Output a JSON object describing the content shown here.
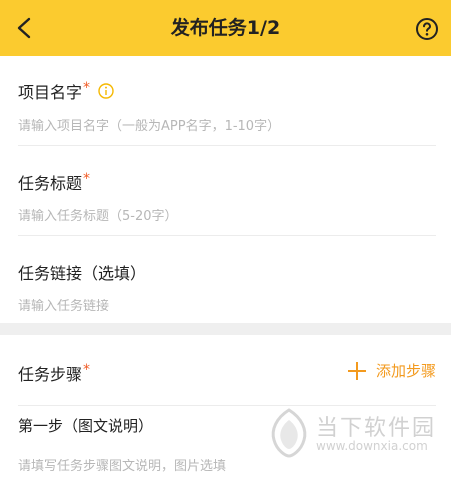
{
  "header": {
    "title": "发布任务1/2",
    "back_icon": "back-arrow-icon",
    "help_icon": "question-circle-icon",
    "bg_color": "#fbcb2f"
  },
  "form": {
    "project_name": {
      "label": "项目名字",
      "required_mark": "*",
      "info_icon": "info-circle-icon",
      "placeholder": "请输入项目名字（一般为APP名字，1-10字）"
    },
    "task_title": {
      "label": "任务标题",
      "required_mark": "*",
      "placeholder": "请输入任务标题（5-20字）"
    },
    "task_link": {
      "label": "任务链接（选填）",
      "placeholder": "请输入任务链接"
    },
    "task_steps": {
      "label": "任务步骤",
      "required_mark": "*",
      "add_label": "添加步骤",
      "add_icon": "plus-icon"
    },
    "step1": {
      "label": "第一步（图文说明）",
      "placeholder": "请填写任务步骤图文说明，图片选填"
    }
  },
  "watermark": {
    "name": "当下软件园",
    "domain": "www.downxia.com"
  },
  "colors": {
    "accent": "#f39a1e",
    "required": "#f15a24",
    "info": "#f5b800",
    "placeholder": "#b7b7b7"
  }
}
